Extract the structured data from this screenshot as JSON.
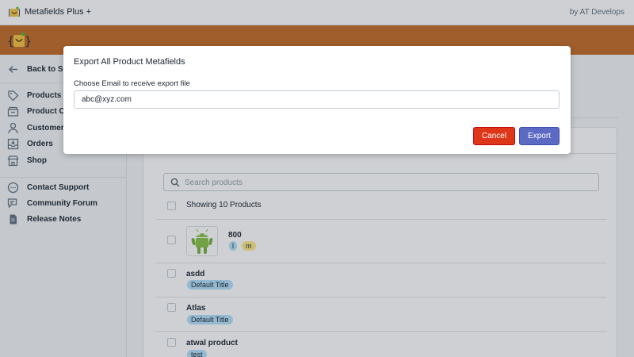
{
  "topbar": {
    "app_title": "Metafields Plus +",
    "by_line": "by AT Develops"
  },
  "sidebar": {
    "items": [
      {
        "label": "Back to Sh",
        "icon": "arrow-left-icon"
      },
      {
        "label": "Products",
        "icon": "tag-icon"
      },
      {
        "label": "Product Co",
        "icon": "collection-icon"
      },
      {
        "label": "Customers",
        "icon": "person-icon"
      },
      {
        "label": "Orders",
        "icon": "inbox-icon"
      },
      {
        "label": "Shop",
        "icon": "store-icon"
      },
      {
        "label": "Contact Support",
        "icon": "chat-icon"
      },
      {
        "label": "Community Forum",
        "icon": "forum-icon"
      },
      {
        "label": "Release Notes",
        "icon": "notes-icon"
      }
    ]
  },
  "main": {
    "search": {
      "placeholder": "Search products"
    },
    "showing": "Showing 10 Products",
    "products": [
      {
        "title": "800",
        "tags": [
          "l",
          "m"
        ]
      },
      {
        "title": "asdd",
        "tags": [
          "Default Title"
        ]
      },
      {
        "title": "Atlas",
        "tags": [
          "Default Title"
        ]
      },
      {
        "title": "atwal product",
        "tags": [
          "test"
        ]
      }
    ]
  },
  "modal": {
    "title": "Export All Product Metafields",
    "label": "Choose Email to receive export file",
    "email_value": "abc@xyz.com",
    "cancel_label": "Cancel",
    "export_label": "Export"
  },
  "colors": {
    "brand": "#c46d2a",
    "primary": "#5c6ac4",
    "destructive": "#de3618",
    "tag_blue": "#b4e1fa",
    "tag_yellow": "#ffea8a"
  }
}
